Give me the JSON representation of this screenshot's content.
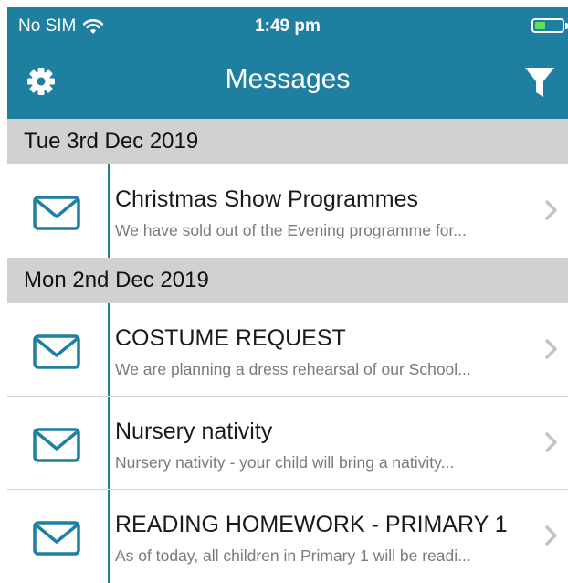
{
  "status_bar": {
    "carrier": "No SIM",
    "time": "1:49 pm",
    "icons": [
      "wifi-icon",
      "battery-icon"
    ],
    "battery_color": "#5fe05f"
  },
  "nav_bar": {
    "title": "Messages",
    "left_icon": "gear-icon",
    "right_icon": "filter-icon",
    "color": "#1e7fa0"
  },
  "sections": [
    {
      "date": "Tue 3rd Dec 2019",
      "messages": [
        {
          "title": "Christmas Show Programmes",
          "preview": "We have sold out of the Evening programme for..."
        }
      ]
    },
    {
      "date": "Mon 2nd Dec 2019",
      "messages": [
        {
          "title": "COSTUME REQUEST",
          "preview": "We are planning a dress rehearsal of our School..."
        },
        {
          "title": "Nursery nativity",
          "preview": "Nursery nativity - your child will bring a nativity..."
        },
        {
          "title": "READING HOMEWORK - PRIMARY 1",
          "preview": "As of today, all children in Primary 1 will be readi..."
        }
      ]
    }
  ],
  "row_icon": "envelope-icon",
  "row_accessory_icon": "chevron-right-icon"
}
